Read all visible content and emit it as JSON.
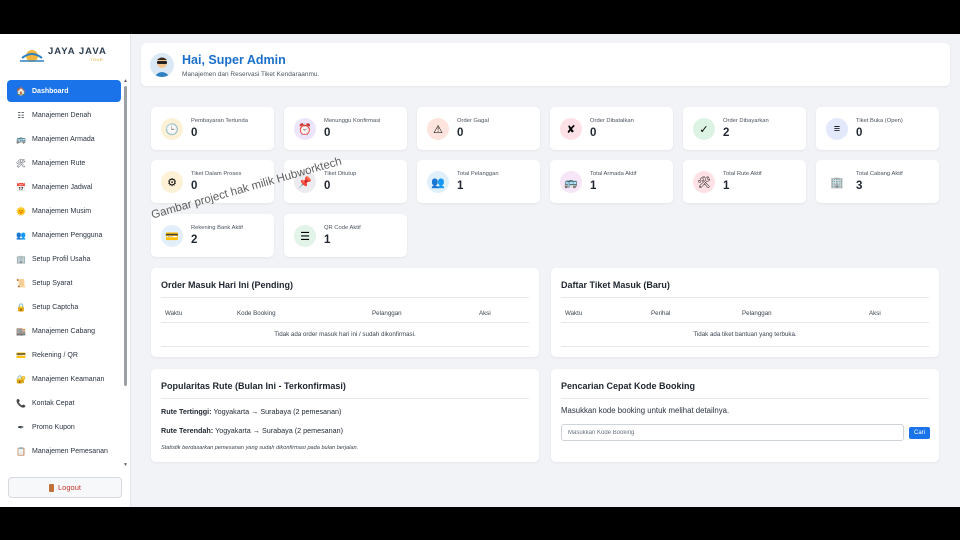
{
  "brand": {
    "name": "JAYA JAVA",
    "tagline": "TOUR"
  },
  "sidebar": {
    "items": [
      {
        "label": "Dashboard",
        "icon": "home-icon",
        "glyph": "🏠"
      },
      {
        "label": "Manajemen Denah",
        "icon": "seat-map-icon",
        "glyph": "☷"
      },
      {
        "label": "Manajemen Armada",
        "icon": "bus-icon",
        "glyph": "🚌"
      },
      {
        "label": "Manajemen Rute",
        "icon": "tools-icon",
        "glyph": "🛠"
      },
      {
        "label": "Manajemen Jadwal",
        "icon": "calendar-icon",
        "glyph": "📅"
      },
      {
        "label": "Manajemen Musim",
        "icon": "season-icon",
        "glyph": "🌞"
      },
      {
        "label": "Manajemen Pengguna",
        "icon": "users-icon",
        "glyph": "👥"
      },
      {
        "label": "Setup Profil Usaha",
        "icon": "building-icon",
        "glyph": "🏢"
      },
      {
        "label": "Setup Syarat",
        "icon": "scroll-icon",
        "glyph": "📜"
      },
      {
        "label": "Setup Captcha",
        "icon": "lock-icon",
        "glyph": "🔒"
      },
      {
        "label": "Manajemen Cabang",
        "icon": "branch-icon",
        "glyph": "🏬"
      },
      {
        "label": "Rekening / QR",
        "icon": "card-icon",
        "glyph": "💳"
      },
      {
        "label": "Manajemen Keamanan",
        "icon": "security-lock-icon",
        "glyph": "🔐"
      },
      {
        "label": "Kontak Cepat",
        "icon": "phone-icon",
        "glyph": "📞"
      },
      {
        "label": "Promo Kupon",
        "icon": "pen-icon",
        "glyph": "✒"
      },
      {
        "label": "Manajemen Pemesanan",
        "icon": "clipboard-icon",
        "glyph": "📋"
      }
    ],
    "logout_label": "Logout"
  },
  "header": {
    "greeting": "Hai, Super Admin",
    "subtitle": "Manajemen dan Reservasi Tiket Kendaraanmu."
  },
  "stats": [
    {
      "label": "Pembayaran Tertunda",
      "value": "0",
      "icon": "clock-icon",
      "glyph": "🕒",
      "bg": "#fdf1d6"
    },
    {
      "label": "Menunggu Konfirmasi",
      "value": "0",
      "icon": "alarm-clock-icon",
      "glyph": "⏰",
      "bg": "#efe5fb"
    },
    {
      "label": "Order Gagal",
      "value": "0",
      "icon": "warning-icon",
      "glyph": "⚠",
      "bg": "#fde4dc"
    },
    {
      "label": "Order Dibatalkan",
      "value": "0",
      "icon": "cross-icon",
      "glyph": "✘",
      "bg": "#fde1e6"
    },
    {
      "label": "Order Dibayarkan",
      "value": "2",
      "icon": "check-icon",
      "glyph": "✓",
      "bg": "#dcf3e4"
    },
    {
      "label": "Tiket Buka (Open)",
      "value": "0",
      "icon": "ticket-icon",
      "glyph": "≡",
      "bg": "#e3e8fb"
    },
    {
      "label": "Tiket Dalam Proses",
      "value": "0",
      "icon": "gear-icon",
      "glyph": "⚙",
      "bg": "#fdf1d6"
    },
    {
      "label": "Tiket Ditutup",
      "value": "0",
      "icon": "pin-icon",
      "glyph": "📌",
      "bg": "#ececf0"
    },
    {
      "label": "Total Pelanggan",
      "value": "1",
      "icon": "customers-icon",
      "glyph": "👥",
      "bg": "#e0f0fb"
    },
    {
      "label": "Total Armada Aktif",
      "value": "1",
      "icon": "bus-icon",
      "glyph": "🚌",
      "bg": "#f6e6f7"
    },
    {
      "label": "Total Rute Aktif",
      "value": "1",
      "icon": "tools-icon",
      "glyph": "🛠",
      "bg": "#fde1e6"
    },
    {
      "label": "Total Cabang Aktif",
      "value": "3",
      "icon": "building-icon",
      "glyph": "🏢",
      "bg": "#ffffff"
    },
    {
      "label": "Rekening Bank Aktif",
      "value": "2",
      "icon": "card-icon",
      "glyph": "💳",
      "bg": "#e3eefb"
    },
    {
      "label": "QR Code Aktif",
      "value": "1",
      "icon": "list-icon",
      "glyph": "☰",
      "bg": "#e2f3e8"
    }
  ],
  "orders_today": {
    "title": "Order Masuk Hari Ini (Pending)",
    "columns": [
      "Waktu",
      "Kode Booking",
      "Pelanggan",
      "Aksi"
    ],
    "empty": "Tidak ada order masuk hari ini / sudah dikonfirmasi."
  },
  "tickets_new": {
    "title": "Daftar Tiket Masuk (Baru)",
    "columns": [
      "Waktu",
      "Perihal",
      "Pelanggan",
      "Aksi"
    ],
    "empty": "Tidak ada tiket bantuan yang terbuka."
  },
  "popular_routes": {
    "title": "Popularitas Rute (Bulan Ini - Terkonfirmasi)",
    "highest_label": "Rute Tertinggi:",
    "highest_value": "Yogyakarta → Surabaya (2 pemesanan)",
    "lowest_label": "Rute Terendah:",
    "lowest_value": "Yogyakarta → Surabaya (2 pemesanan)",
    "note": "Statistik berdasarkan pemesanan yang sudah dikonfirmasi pada bulan berjalan."
  },
  "quick_search": {
    "title": "Pencarian Cepat Kode Booking",
    "description": "Masukkan kode booking untuk melihat detailnya.",
    "placeholder": "Masukkan Kode Booking",
    "button_label": "Cari"
  },
  "watermark": "Gambar project hak milik Hubworktech",
  "colors": {
    "accent": "#1a73e8",
    "title_blue": "#1a6fc9",
    "logout_red": "#c0392b"
  }
}
